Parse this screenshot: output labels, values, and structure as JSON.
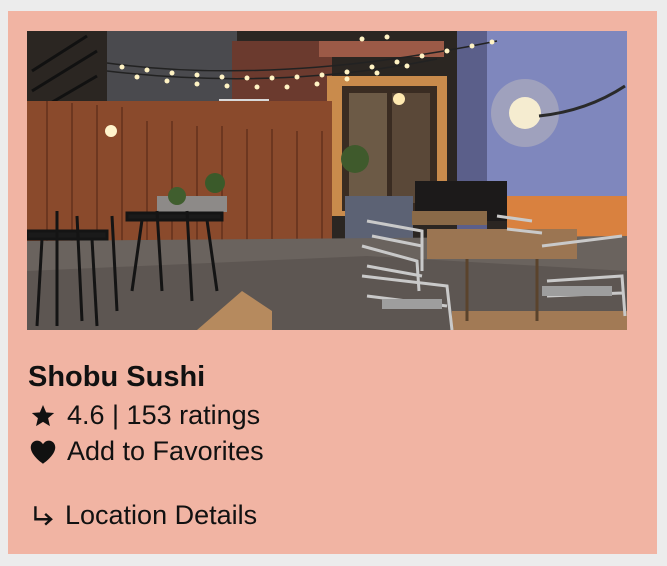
{
  "card": {
    "restaurant_name": "Shobu Sushi",
    "rating_text": "4.6 | 153 ratings",
    "favorite_label": "Add to Favorites",
    "location_label": "Location Details",
    "icons": {
      "rating": "star-icon",
      "favorite": "heart-icon",
      "location": "return-arrow-icon"
    },
    "colors": {
      "card_background": "#f1b4a3",
      "page_background": "#ececec",
      "text": "#111111"
    }
  }
}
